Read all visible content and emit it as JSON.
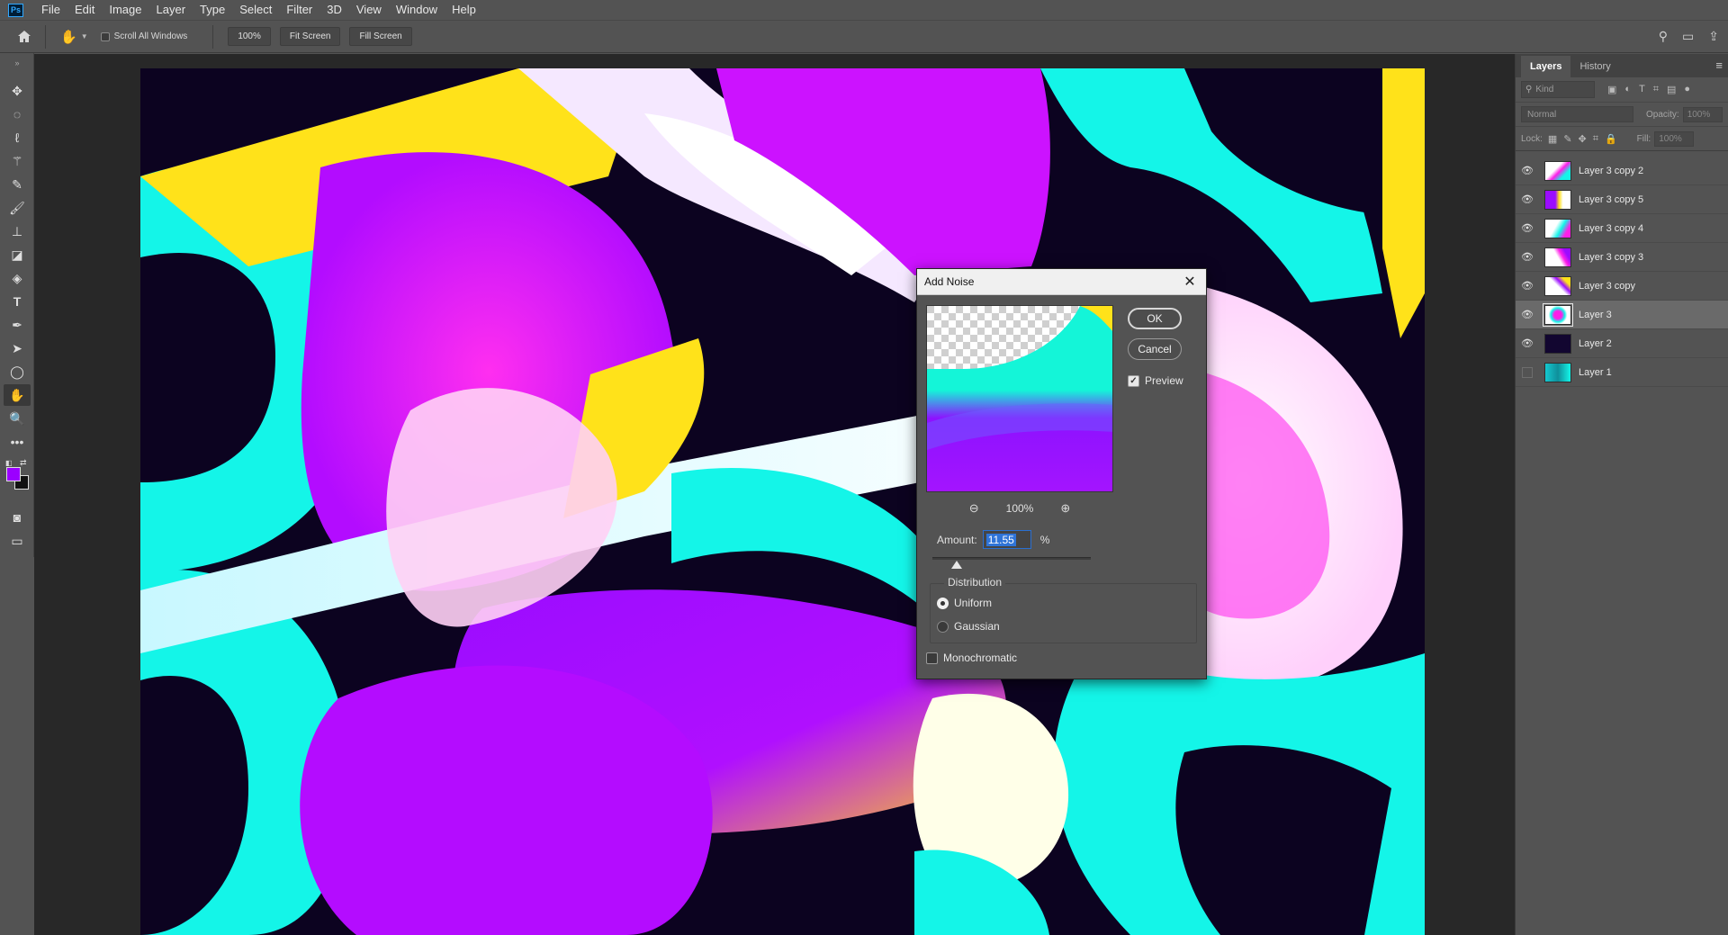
{
  "app": {
    "logo": "Ps"
  },
  "menubar": {
    "items": [
      "File",
      "Edit",
      "Image",
      "Layer",
      "Type",
      "Select",
      "Filter",
      "3D",
      "View",
      "Window",
      "Help"
    ]
  },
  "options_bar": {
    "scroll_all_windows": "Scroll All Windows",
    "zoom_btn": "100%",
    "fit_screen": "Fit Screen",
    "fill_screen": "Fill Screen"
  },
  "toolbar": {
    "tools": [
      "move-icon",
      "marquee-icon",
      "lasso-icon",
      "magic-wand-icon",
      "eyedropper-icon",
      "brush-icon",
      "stamp-icon",
      "eraser-icon",
      "paint-bucket-icon",
      "type-icon",
      "pen-icon",
      "path-select-icon",
      "ellipse-icon",
      "hand-icon",
      "zoom-icon",
      "more-icon"
    ],
    "foreground_color": "#9b00ff",
    "background_color": "#111111"
  },
  "panel": {
    "tabs": [
      "Layers",
      "History"
    ],
    "kind_placeholder": "Kind",
    "blend_mode": "Normal",
    "opacity_label": "Opacity:",
    "opacity_value": "100%",
    "lock_label": "Lock:",
    "fill_label": "Fill:",
    "fill_value": "100%",
    "layers": [
      {
        "name": "Layer 3 copy 2",
        "visible": true,
        "selected": false
      },
      {
        "name": "Layer 3 copy 5",
        "visible": true,
        "selected": false
      },
      {
        "name": "Layer 3 copy 4",
        "visible": true,
        "selected": false
      },
      {
        "name": "Layer 3 copy 3",
        "visible": true,
        "selected": false
      },
      {
        "name": "Layer 3 copy",
        "visible": true,
        "selected": false
      },
      {
        "name": "Layer 3",
        "visible": true,
        "selected": true
      },
      {
        "name": "Layer 2",
        "visible": true,
        "selected": false
      },
      {
        "name": "Layer 1",
        "visible": false,
        "selected": false
      }
    ]
  },
  "dialog": {
    "title": "Add Noise",
    "ok": "OK",
    "cancel": "Cancel",
    "preview_label": "Preview",
    "preview_checked": true,
    "zoom_value": "100%",
    "amount_label": "Amount:",
    "amount_value": "11.55",
    "amount_unit": "%",
    "distribution_label": "Distribution",
    "uniform": "Uniform",
    "gaussian": "Gaussian",
    "selected_distribution": "Uniform",
    "monochromatic": "Monochromatic",
    "monochromatic_checked": false
  },
  "colors": {
    "canvas_bg": "#0c0320",
    "cyan": "#14f5e8",
    "magenta": "#ff1ee8",
    "purple": "#9b0cff",
    "yellow": "#ffe21a"
  }
}
